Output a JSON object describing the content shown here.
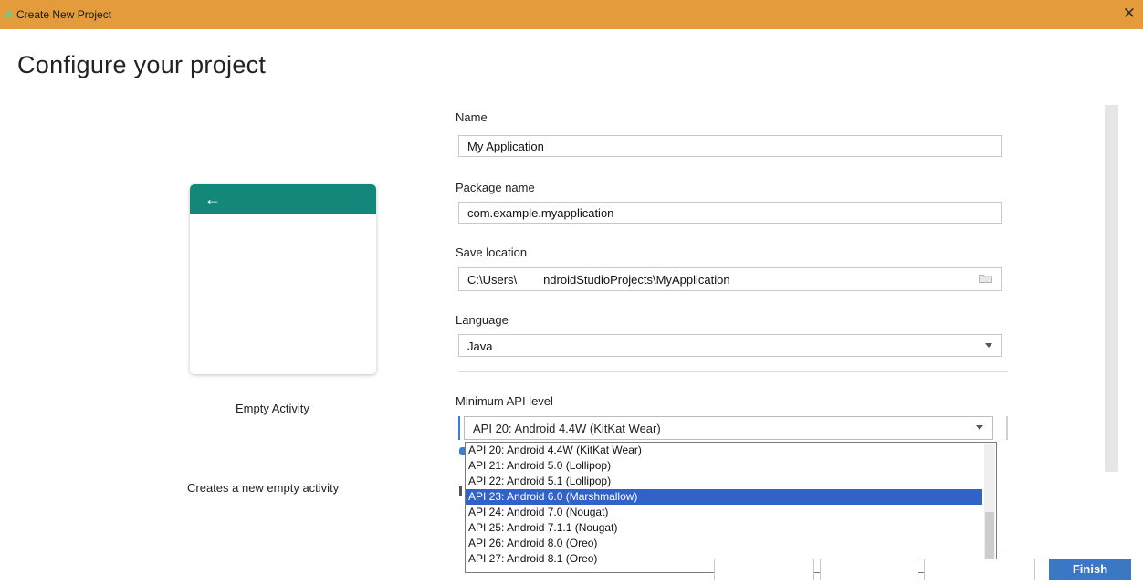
{
  "window": {
    "title": "Create New Project",
    "close_glyph": "✕"
  },
  "page": {
    "title": "Configure your project"
  },
  "preview": {
    "back_glyph": "←",
    "template_name": "Empty Activity",
    "template_description": "Creates a new empty activity",
    "toolbar_color": "#13877a"
  },
  "form": {
    "name": {
      "label": "Name",
      "value": "My Application"
    },
    "package": {
      "label": "Package name",
      "value": "com.example.myapplication"
    },
    "save_location": {
      "label": "Save location",
      "value": "C:\\Users\\        ndroidStudioProjects\\MyApplication",
      "icon": "folder-icon"
    },
    "language": {
      "label": "Language",
      "value": "Java",
      "icon": "chevron-down-icon"
    },
    "min_api": {
      "label": "Minimum API level",
      "value": "API 20: Android 4.4W (KitKat Wear)",
      "options": [
        "API 20: Android 4.4W (KitKat Wear)",
        "API 21: Android 5.0 (Lollipop)",
        "API 22: Android 5.1 (Lollipop)",
        "API 23: Android 6.0 (Marshmallow)",
        "API 24: Android 7.0 (Nougat)",
        "API 25: Android 7.1.1 (Nougat)",
        "API 26: Android 8.0 (Oreo)",
        "API 27: Android 8.1 (Oreo)"
      ],
      "highlighted_index": 3
    }
  },
  "footer": {
    "finish_label": "Finish",
    "accent_color": "#3b78c4"
  },
  "colors": {
    "titlebar": "#e39b3c",
    "selection": "#3162c7"
  }
}
